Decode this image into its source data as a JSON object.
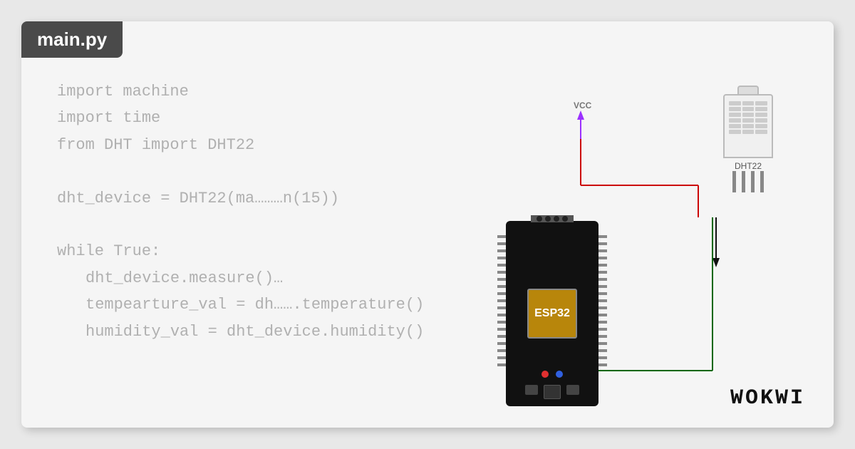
{
  "title": "main.py",
  "code": {
    "lines": [
      {
        "text": "import machine",
        "indent": false
      },
      {
        "text": "import time",
        "indent": false
      },
      {
        "text": "from DHT import DHT22",
        "indent": false
      },
      {
        "text": "",
        "indent": false
      },
      {
        "text": "dht_device = DHT22(ma………n(15))",
        "indent": false
      },
      {
        "text": "",
        "indent": false
      },
      {
        "text": "while True:",
        "indent": false
      },
      {
        "text": "dht_device.measure()…",
        "indent": true
      },
      {
        "text": "tempearture_val = dh…….temperature()",
        "indent": true
      },
      {
        "text": "humidity_val = dht_device.humidity()",
        "indent": true
      }
    ]
  },
  "sensor": {
    "label": "DHT22"
  },
  "vcc_label": "VCC",
  "chip_label": "ESP32",
  "wokwi": "WOKWi"
}
